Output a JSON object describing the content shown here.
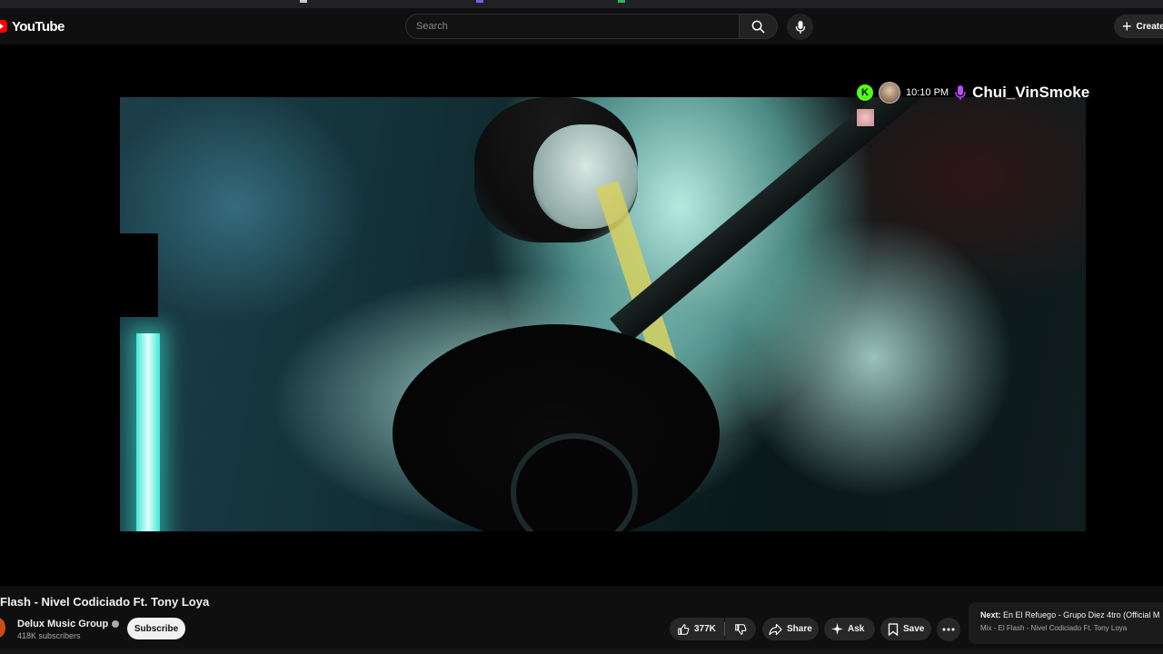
{
  "app": {
    "logo_text": "YouTube"
  },
  "header": {
    "search_placeholder": "Search",
    "create_label": "Create"
  },
  "stream_overlay": {
    "time": "10:10 PM",
    "username": "Chui_VinSmoke"
  },
  "video": {
    "title": "Flash - Nivel Codiciado Ft. Tony Loya",
    "channel": "Delux Music Group",
    "subscribers": "418K subscribers",
    "subscribe_label": "Subscribe"
  },
  "actions": {
    "likes": "377K",
    "share_label": "Share",
    "ask_label": "Ask",
    "save_label": "Save"
  },
  "up_next": {
    "prefix": "Next:",
    "title": "En El Refuego - Grupo Diez 4tro (Official M",
    "subtitle": "Mix - El Flash - Nivel Codiciado Ft. Tony Loya"
  },
  "icons": [
    "youtube-logo-icon",
    "search-icon",
    "mic-icon",
    "plus-icon",
    "kick-icon",
    "purple-mic-icon",
    "verified-icon",
    "thumbs-up-icon",
    "thumbs-down-icon",
    "share-icon",
    "sparkle-icon",
    "bookmark-icon",
    "more-icon"
  ],
  "colors": {
    "brand_red": "#ff0000",
    "kick_green": "#53fc18",
    "mic_purple": "#b84dff",
    "background": "#0f0f0f"
  }
}
